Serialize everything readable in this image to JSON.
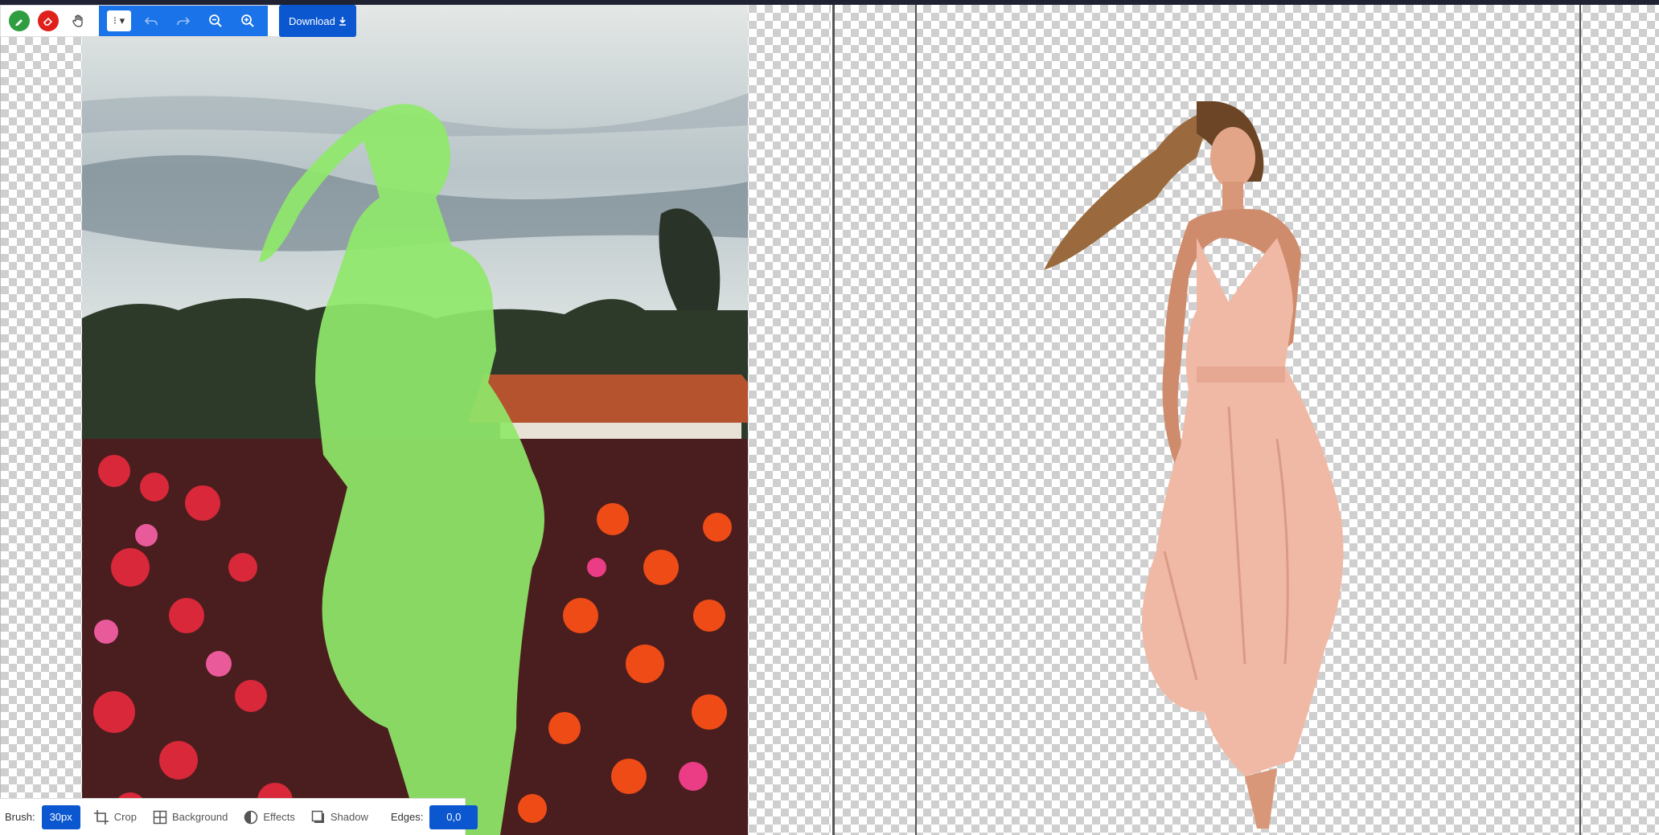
{
  "toolbar": {
    "tools": [
      {
        "name": "restore-brush-icon",
        "color": "#2e9e41"
      },
      {
        "name": "erase-brush-icon",
        "color": "#e0201b"
      },
      {
        "name": "hand-pan-icon"
      }
    ],
    "select_label": "⁝ ▾",
    "undo_icon": "undo-icon",
    "redo_icon": "redo-icon",
    "zoom_out_icon": "zoom-out-icon",
    "zoom_in_icon": "zoom-in-icon",
    "download_label": "Download",
    "accent": "#1a73e8",
    "download_color": "#0b57d0"
  },
  "bottom": {
    "brush_label": "Brush:",
    "brush_value": "30px",
    "crop_label": "Crop",
    "background_label": "Background",
    "effects_label": "Effects",
    "shadow_label": "Shadow",
    "edges_label": "Edges:",
    "edges_value": "0,0"
  },
  "canvas": {
    "left_overlay_color": "#8fe86a",
    "right_dress_color": "#f0b9a6"
  }
}
